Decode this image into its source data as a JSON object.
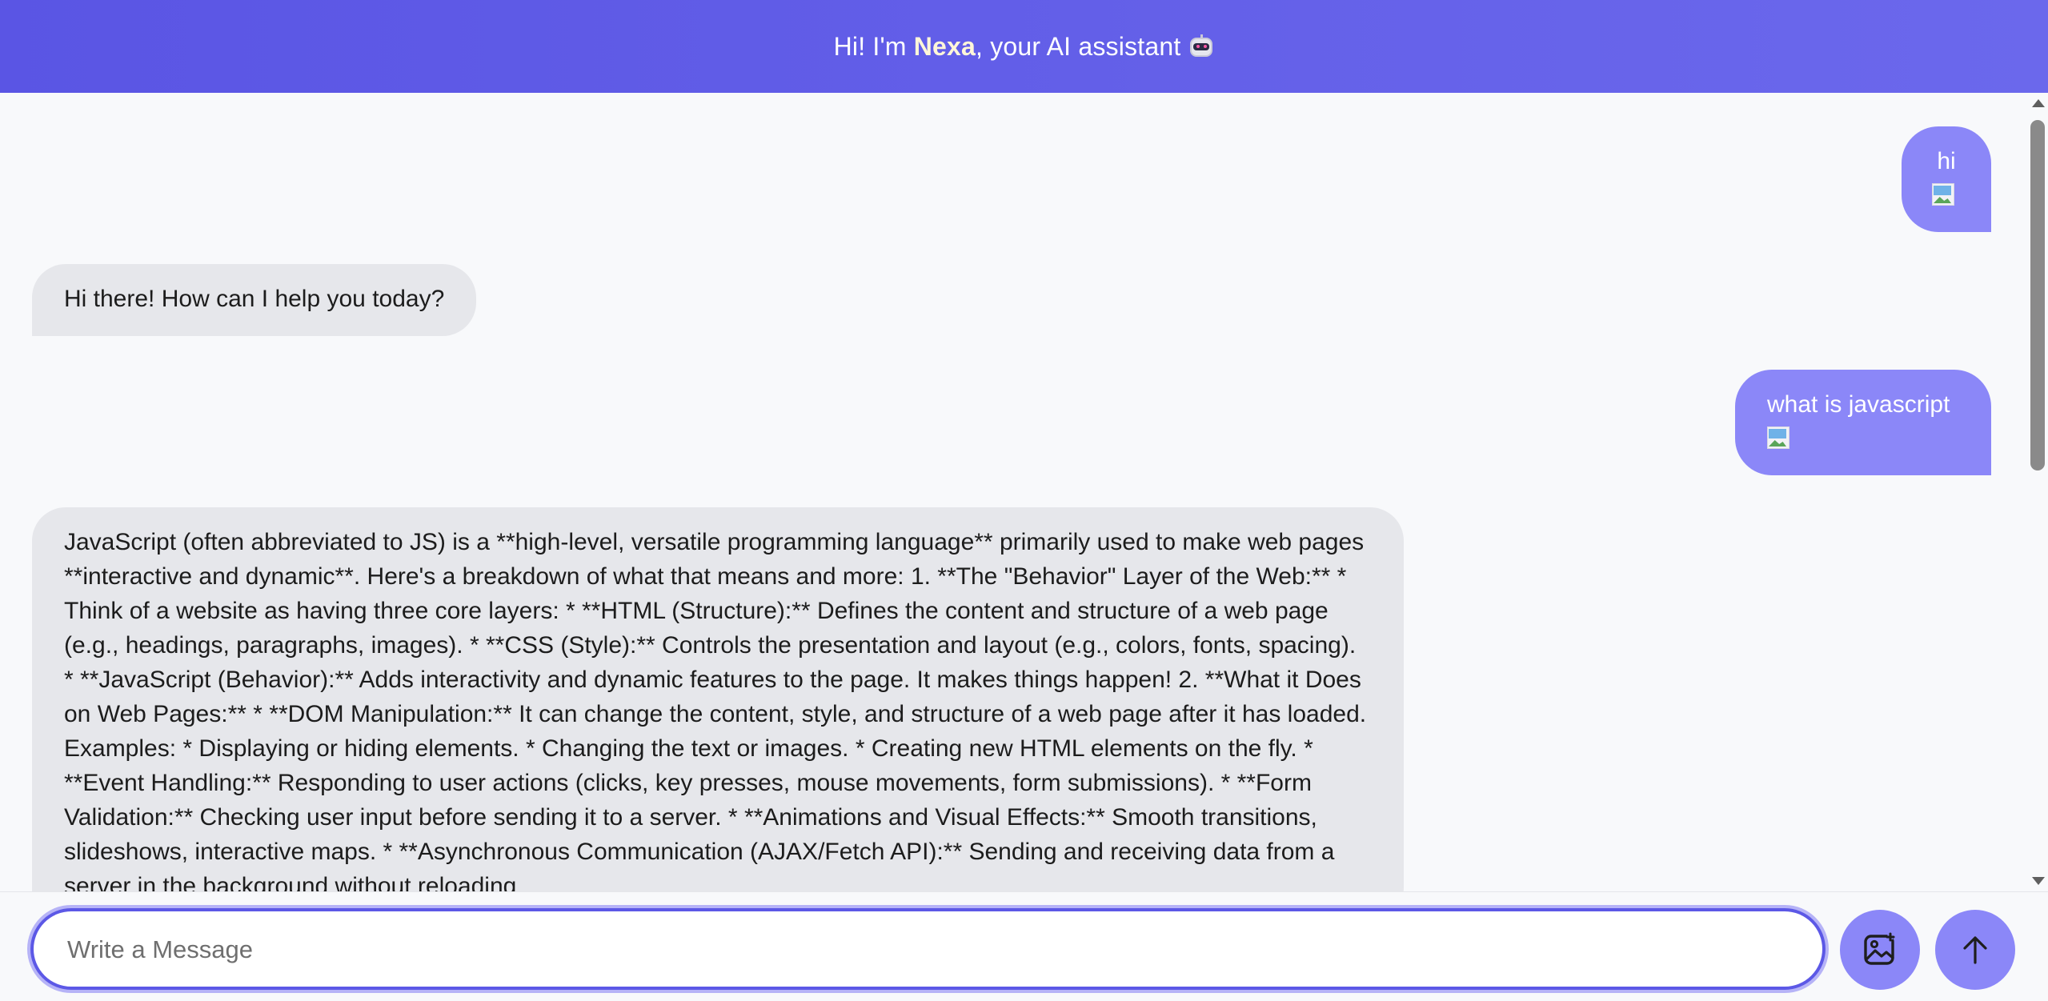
{
  "header": {
    "prefix": "Hi! I'm ",
    "brand": "Nexa",
    "suffix": ", your AI assistant",
    "icon": "robot-icon",
    "gradient_start": "#5a55e4",
    "gradient_end": "#6b68ec"
  },
  "colors": {
    "accent": "#5c58e6",
    "user_bubble": "#8b87f8",
    "bot_bubble": "#e6e7eb",
    "background": "#f8f9fb"
  },
  "messages": [
    {
      "role": "user",
      "text": "hi",
      "attachment_icon": "broken-image-icon"
    },
    {
      "role": "bot",
      "text": "Hi there! How can I help you today?"
    },
    {
      "role": "user",
      "text": "what is javascript",
      "attachment_icon": "broken-image-icon"
    },
    {
      "role": "bot",
      "text": "JavaScript (often abbreviated to JS) is a **high-level, versatile programming language** primarily used to make web pages **interactive and dynamic**. Here's a breakdown of what that means and more: 1. **The \"Behavior\" Layer of the Web:** * Think of a website as having three core layers: * **HTML (Structure):** Defines the content and structure of a web page (e.g., headings, paragraphs, images). * **CSS (Style):** Controls the presentation and layout (e.g., colors, fonts, spacing). * **JavaScript (Behavior):** Adds interactivity and dynamic features to the page. It makes things happen! 2. **What it Does on Web Pages:** * **DOM Manipulation:** It can change the content, style, and structure of a web page after it has loaded. Examples: * Displaying or hiding elements. * Changing the text or images. * Creating new HTML elements on the fly. * **Event Handling:** Responding to user actions (clicks, key presses, mouse movements, form submissions). * **Form Validation:** Checking user input before sending it to a server. * **Animations and Visual Effects:** Smooth transitions, slideshows, interactive maps. * **Asynchronous Communication (AJAX/Fetch API):** Sending and receiving data from a server in the background without reloading"
    }
  ],
  "composer": {
    "placeholder": "Write a Message",
    "value": "",
    "photo_icon": "image-upload-icon",
    "send_icon": "arrow-up-icon"
  }
}
